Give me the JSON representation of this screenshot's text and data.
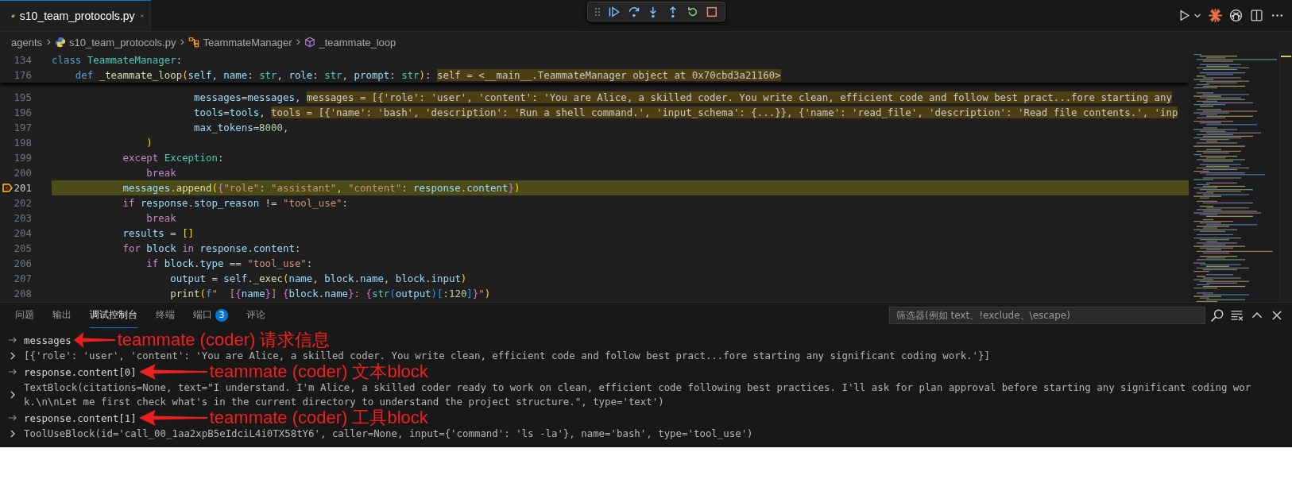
{
  "editor_tab": {
    "filename": "s10_team_protocols.py",
    "selected": true
  },
  "debug_toolbar": [
    {
      "kind": "gripper"
    },
    {
      "kind": "continue"
    },
    {
      "kind": "step_over"
    },
    {
      "kind": "step_into"
    },
    {
      "kind": "step_out"
    },
    {
      "kind": "restart"
    },
    {
      "kind": "stop"
    }
  ],
  "editor_actions": [
    {
      "kind": "run"
    },
    {
      "kind": "run_menu"
    },
    {
      "kind": "sparkle"
    },
    {
      "kind": "knot"
    },
    {
      "kind": "split"
    },
    {
      "kind": "more"
    }
  ],
  "breadcrumbs": [
    {
      "label": "agents",
      "kind": "folder"
    },
    {
      "label": "s10_team_protocols.py",
      "kind": "python"
    },
    {
      "label": "TeammateManager",
      "kind": "class"
    },
    {
      "label": "_teammate_loop",
      "kind": "method"
    }
  ],
  "sticky_lines": [
    {
      "number": "134",
      "current": false,
      "tokens": [
        {
          "text": "class ",
          "kind": "def"
        },
        {
          "text": "TeammateManager",
          "kind": "type"
        },
        {
          "text": ":",
          "kind": "plain"
        }
      ]
    },
    {
      "number": "176",
      "current": false,
      "tokens": [
        {
          "text": "    def ",
          "kind": "def"
        },
        {
          "text": "_teammate_loop",
          "kind": "func"
        },
        {
          "text": "(",
          "kind": "b1"
        },
        {
          "text": "self",
          "kind": "var"
        },
        {
          "text": ", ",
          "kind": "plain"
        },
        {
          "text": "name",
          "kind": "var"
        },
        {
          "text": ": ",
          "kind": "plain"
        },
        {
          "text": "str",
          "kind": "type"
        },
        {
          "text": ", ",
          "kind": "plain"
        },
        {
          "text": "role",
          "kind": "var"
        },
        {
          "text": ": ",
          "kind": "plain"
        },
        {
          "text": "str",
          "kind": "type"
        },
        {
          "text": ", ",
          "kind": "plain"
        },
        {
          "text": "prompt",
          "kind": "var"
        },
        {
          "text": ": ",
          "kind": "plain"
        },
        {
          "text": "str",
          "kind": "type"
        },
        {
          "text": ")",
          "kind": "b1"
        },
        {
          "text": ": ",
          "kind": "plain"
        }
      ],
      "inline_value": "self = <__main__.TeammateManager object at 0x70cbd3a21160>"
    }
  ],
  "code_lines": [
    {
      "number": "195",
      "current": false,
      "tokens": [
        {
          "text": "                        messages",
          "kind": "var"
        },
        {
          "text": "=",
          "kind": "plain"
        },
        {
          "text": "messages",
          "kind": "var"
        },
        {
          "text": ", ",
          "kind": "plain"
        }
      ],
      "inline_value": "messages = [{'role': 'user', 'content': 'You are Alice, a skilled coder. You write clean, efficient code and follow best pract...fore starting any"
    },
    {
      "number": "196",
      "current": false,
      "tokens": [
        {
          "text": "                        tools",
          "kind": "var"
        },
        {
          "text": "=",
          "kind": "plain"
        },
        {
          "text": "tools",
          "kind": "var"
        },
        {
          "text": ", ",
          "kind": "plain"
        }
      ],
      "inline_value": "tools = [{'name': 'bash', 'description': 'Run a shell command.', 'input_schema': {...}}, {'name': 'read_file', 'description': 'Read file contents.', 'inp"
    },
    {
      "number": "197",
      "current": false,
      "tokens": [
        {
          "text": "                        max_tokens",
          "kind": "var"
        },
        {
          "text": "=",
          "kind": "plain"
        },
        {
          "text": "8000",
          "kind": "number"
        },
        {
          "text": ",",
          "kind": "plain"
        }
      ]
    },
    {
      "number": "198",
      "current": false,
      "tokens": [
        {
          "text": "                )",
          "kind": "b1"
        }
      ]
    },
    {
      "number": "199",
      "current": false,
      "tokens": [
        {
          "text": "            except ",
          "kind": "keyword"
        },
        {
          "text": "Exception",
          "kind": "type"
        },
        {
          "text": ":",
          "kind": "plain"
        }
      ]
    },
    {
      "number": "200",
      "current": false,
      "tokens": [
        {
          "text": "                break",
          "kind": "keyword"
        }
      ]
    },
    {
      "number": "201",
      "current": true,
      "tokens": [
        {
          "text": "            messages",
          "kind": "var"
        },
        {
          "text": ".",
          "kind": "plain"
        },
        {
          "text": "append",
          "kind": "func"
        },
        {
          "text": "(",
          "kind": "b1"
        },
        {
          "text": "{",
          "kind": "b2"
        },
        {
          "text": "\"role\"",
          "kind": "string"
        },
        {
          "text": ": ",
          "kind": "plain"
        },
        {
          "text": "\"assistant\"",
          "kind": "string"
        },
        {
          "text": ", ",
          "kind": "plain"
        },
        {
          "text": "\"content\"",
          "kind": "string"
        },
        {
          "text": ": ",
          "kind": "plain"
        },
        {
          "text": "response",
          "kind": "var"
        },
        {
          "text": ".",
          "kind": "plain"
        },
        {
          "text": "content",
          "kind": "var"
        },
        {
          "text": "}",
          "kind": "b2"
        },
        {
          "text": ")",
          "kind": "b1"
        }
      ]
    },
    {
      "number": "202",
      "current": false,
      "tokens": [
        {
          "text": "            if ",
          "kind": "keyword"
        },
        {
          "text": "response",
          "kind": "var"
        },
        {
          "text": ".",
          "kind": "plain"
        },
        {
          "text": "stop_reason",
          "kind": "var"
        },
        {
          "text": " != ",
          "kind": "plain"
        },
        {
          "text": "\"tool_use\"",
          "kind": "string"
        },
        {
          "text": ":",
          "kind": "plain"
        }
      ]
    },
    {
      "number": "203",
      "current": false,
      "tokens": [
        {
          "text": "                break",
          "kind": "keyword"
        }
      ]
    },
    {
      "number": "204",
      "current": false,
      "tokens": [
        {
          "text": "            results",
          "kind": "var"
        },
        {
          "text": " = ",
          "kind": "plain"
        },
        {
          "text": "[]",
          "kind": "b1"
        }
      ]
    },
    {
      "number": "205",
      "current": false,
      "tokens": [
        {
          "text": "            for ",
          "kind": "keyword"
        },
        {
          "text": "block ",
          "kind": "var"
        },
        {
          "text": "in ",
          "kind": "keyword"
        },
        {
          "text": "response",
          "kind": "var"
        },
        {
          "text": ".",
          "kind": "plain"
        },
        {
          "text": "content",
          "kind": "var"
        },
        {
          "text": ":",
          "kind": "plain"
        }
      ]
    },
    {
      "number": "206",
      "current": false,
      "tokens": [
        {
          "text": "                if ",
          "kind": "keyword"
        },
        {
          "text": "block",
          "kind": "var"
        },
        {
          "text": ".",
          "kind": "plain"
        },
        {
          "text": "type",
          "kind": "var"
        },
        {
          "text": " == ",
          "kind": "plain"
        },
        {
          "text": "\"tool_use\"",
          "kind": "string"
        },
        {
          "text": ":",
          "kind": "plain"
        }
      ]
    },
    {
      "number": "207",
      "current": false,
      "tokens": [
        {
          "text": "                    output",
          "kind": "var"
        },
        {
          "text": " = ",
          "kind": "plain"
        },
        {
          "text": "self",
          "kind": "var"
        },
        {
          "text": ".",
          "kind": "plain"
        },
        {
          "text": "_exec",
          "kind": "func"
        },
        {
          "text": "(",
          "kind": "b1"
        },
        {
          "text": "name",
          "kind": "var"
        },
        {
          "text": ", ",
          "kind": "plain"
        },
        {
          "text": "block",
          "kind": "var"
        },
        {
          "text": ".",
          "kind": "plain"
        },
        {
          "text": "name",
          "kind": "var"
        },
        {
          "text": ", ",
          "kind": "plain"
        },
        {
          "text": "block",
          "kind": "var"
        },
        {
          "text": ".",
          "kind": "plain"
        },
        {
          "text": "input",
          "kind": "var"
        },
        {
          "text": ")",
          "kind": "b1"
        }
      ]
    },
    {
      "number": "208",
      "current": false,
      "tokens": [
        {
          "text": "                    print",
          "kind": "func"
        },
        {
          "text": "(",
          "kind": "b1"
        },
        {
          "text": "f",
          "kind": "def"
        },
        {
          "text": "\"  [",
          "kind": "string"
        },
        {
          "text": "{",
          "kind": "b2"
        },
        {
          "text": "name",
          "kind": "var"
        },
        {
          "text": "}",
          "kind": "b2"
        },
        {
          "text": "] ",
          "kind": "string"
        },
        {
          "text": "{",
          "kind": "b2"
        },
        {
          "text": "block",
          "kind": "var"
        },
        {
          "text": ".",
          "kind": "plain"
        },
        {
          "text": "name",
          "kind": "var"
        },
        {
          "text": "}",
          "kind": "b2"
        },
        {
          "text": ": ",
          "kind": "string"
        },
        {
          "text": "{",
          "kind": "b2"
        },
        {
          "text": "str",
          "kind": "type"
        },
        {
          "text": "(",
          "kind": "b3"
        },
        {
          "text": "output",
          "kind": "var"
        },
        {
          "text": ")",
          "kind": "b3"
        },
        {
          "text": "[",
          "kind": "b3"
        },
        {
          "text": ":",
          "kind": "plain"
        },
        {
          "text": "120",
          "kind": "number"
        },
        {
          "text": "]",
          "kind": "b3"
        },
        {
          "text": "}",
          "kind": "b2"
        },
        {
          "text": "\"",
          "kind": "string"
        },
        {
          "text": ")",
          "kind": "b1"
        }
      ]
    }
  ],
  "panel": {
    "tabs": [
      {
        "label": "问题",
        "selected": false
      },
      {
        "label": "输出",
        "selected": false
      },
      {
        "label": "调试控制台",
        "selected": true
      },
      {
        "label": "终端",
        "selected": false
      },
      {
        "label": "端口",
        "selected": false,
        "badge": "3"
      },
      {
        "label": "评论",
        "selected": false
      }
    ],
    "filter": {
      "placeholder": "筛选器(例如 text、!exclude、\\escape)"
    },
    "actions": [
      {
        "kind": "search"
      },
      {
        "kind": "clear"
      },
      {
        "kind": "collapse"
      },
      {
        "kind": "close"
      }
    ],
    "console": [
      {
        "kind": "input",
        "text": "messages",
        "annotation": "teammate (coder) 请求信息"
      },
      {
        "kind": "output",
        "expanded": false,
        "lines": [
          "[{'role': 'user', 'content': 'You are Alice, a skilled coder. You write clean, efficient code and follow best pract...fore starting any significant coding work.'}]"
        ]
      },
      {
        "kind": "input",
        "text": "response.content[0]",
        "annotation": "teammate (coder) 文本block"
      },
      {
        "kind": "output",
        "expanded": false,
        "lines": [
          "TextBlock(citations=None, text=\"I understand. I'm Alice, a skilled coder ready to work on clean, efficient code following best practices. I'll ask for plan approval before starting any significant coding wor",
          "k.\\n\\nLet me first check what's in the current directory to understand the project structure.\", type='text')"
        ]
      },
      {
        "kind": "input",
        "text": "response.content[1]",
        "annotation": "teammate (coder) 工具block"
      },
      {
        "kind": "output",
        "expanded": false,
        "lines": [
          "ToolUseBlock(id='call_00_1aa2xpB5eIdciL4i0TX58tY6', caller=None, input={'command': 'ls -la'}, name='bash', type='tool_use')"
        ]
      }
    ]
  }
}
